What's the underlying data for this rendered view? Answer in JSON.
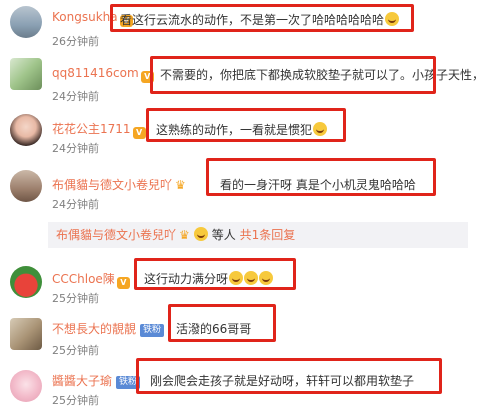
{
  "comments": [
    {
      "user": "Kongsukha",
      "time": "26分钟前",
      "text": "看这行云流水的动作，不是第一次了哈哈哈哈哈哈"
    },
    {
      "user": "qq811416com",
      "time": "24分钟前",
      "text": "不需要的，你把底下都换成软胶垫子就可以了。小孩子天性，"
    },
    {
      "user": "花花公主1711",
      "time": "24分钟前",
      "text": "这熟练的动作，一看就是惯犯"
    },
    {
      "user": "布偶貓与德文小卷兒吖",
      "time": "24分钟前",
      "text": "看的一身汗呀 真是个小机灵鬼哈哈哈"
    },
    {
      "user": "CCChloe陳",
      "time": "25分钟前",
      "text": "这行动力满分呀"
    },
    {
      "user": "不想長大的靚靚",
      "badge": "铁粉",
      "time": "25分钟前",
      "text": "活潑的66哥哥"
    },
    {
      "user": "醬醬大子瑜",
      "badge": "铁粉",
      "time": "25分钟前",
      "text": "刚会爬会走孩子就是好动呀，轩轩可以都用软垫子"
    }
  ],
  "reply_bar": {
    "user": "布偶貓与德文小卷兒吖",
    "middle": "等人",
    "link": "共1条回复"
  },
  "colors": {
    "username": "#eb7350",
    "highlight_box": "#e0241a",
    "time": "#808080"
  }
}
